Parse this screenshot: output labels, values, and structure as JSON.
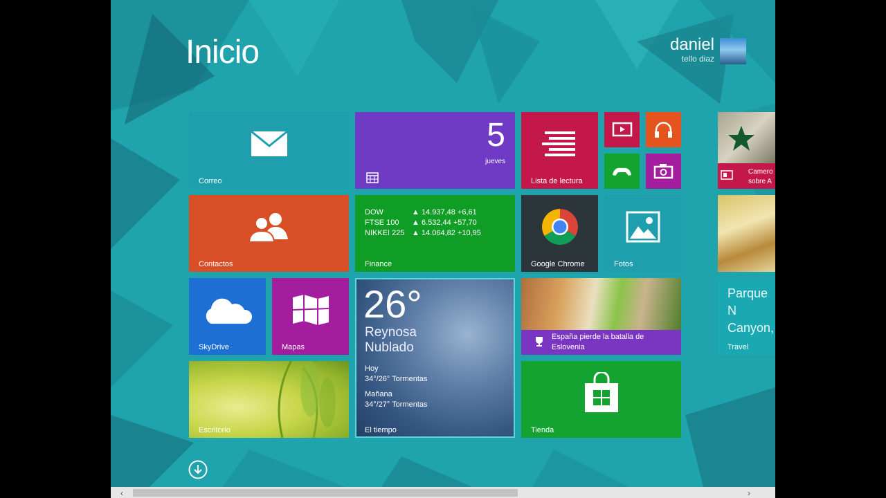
{
  "page": {
    "title": "Inicio"
  },
  "user": {
    "first_name": "daniel",
    "last_name": "tello diaz"
  },
  "tiles": {
    "mail": {
      "label": "Correo"
    },
    "calendar": {
      "day_number": "5",
      "day_name": "jueves"
    },
    "reading_list": {
      "label": "Lista de lectura"
    },
    "contacts": {
      "label": "Contactos"
    },
    "finance": {
      "label": "Finance",
      "rows": [
        {
          "name": "DOW",
          "value": "▲ 14.937,48 +6,61"
        },
        {
          "name": "FTSE 100",
          "value": "▲ 6.532,44 +57,70"
        },
        {
          "name": "NIKKEI 225",
          "value": "▲ 14.064,82 +10,95"
        }
      ]
    },
    "chrome": {
      "label": "Google Chrome"
    },
    "photos": {
      "label": "Fotos"
    },
    "skydrive": {
      "label": "SkyDrive"
    },
    "maps": {
      "label": "Mapas"
    },
    "weather": {
      "label": "El tiempo",
      "temperature": "26°",
      "city": "Reynosa",
      "condition": "Nublado",
      "today_label": "Hoy",
      "today_forecast": "34°/26° Tormentas",
      "tomorrow_label": "Mañana",
      "tomorrow_forecast": "34°/27° Tormentas"
    },
    "sports": {
      "headline": "España pierde la batalla de Eslovenia"
    },
    "desktop": {
      "label": "Escritorio"
    },
    "store": {
      "label": "Tienda"
    },
    "news_partial": {
      "text": "Camero sobre A"
    },
    "travel": {
      "text": "Parque N Canyon,",
      "label": "Travel"
    }
  },
  "scrollbar": {
    "left_arrow": "‹",
    "right_arrow": "›"
  },
  "colors": {
    "background": "#1fa4ad",
    "mail": "#1f9eae",
    "calendar": "#6f3bc4",
    "reading_list": "#c4184a",
    "contacts": "#d84f27",
    "finance": "#0f9d26",
    "chrome": "#2c3539",
    "skydrive": "#1d6fd3",
    "maps": "#a41d9f",
    "sports": "#7a35c1",
    "store": "#14a330"
  }
}
